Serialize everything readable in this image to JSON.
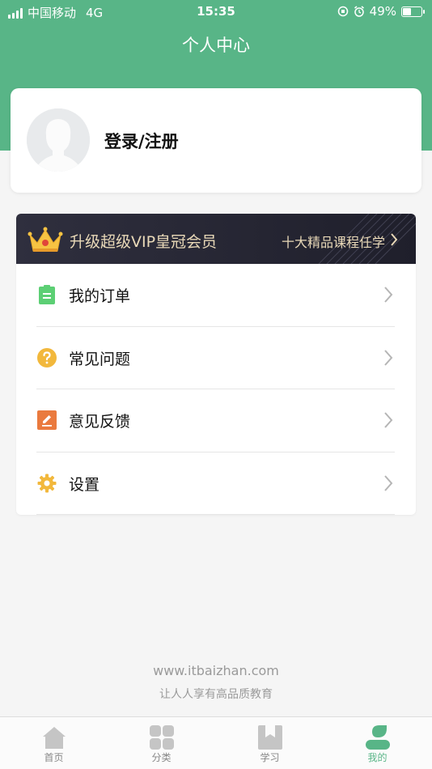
{
  "status_bar": {
    "carrier": "中国移动",
    "network": "4G",
    "time": "15:35",
    "battery": "49%",
    "battery_level": 0.49
  },
  "header": {
    "title": "个人中心"
  },
  "profile": {
    "login_label": "登录/注册",
    "avatar_icon": "default-avatar-icon"
  },
  "vip": {
    "title": "升级超级VIP皇冠会员",
    "subtitle": "十大精品课程任学",
    "icon": "crown-icon"
  },
  "menu": [
    {
      "label": "我的订单",
      "icon": "clipboard-icon",
      "color": "#5ccf74"
    },
    {
      "label": "常见问题",
      "icon": "question-icon",
      "color": "#f2b83c"
    },
    {
      "label": "意见反馈",
      "icon": "edit-icon",
      "color": "#ea7a3e"
    },
    {
      "label": "设置",
      "icon": "gear-icon",
      "color": "#f2b83c"
    }
  ],
  "footer": {
    "url": "www.itbaizhan.com",
    "slogan": "让人人享有高品质教育"
  },
  "tabs": [
    {
      "label": "首页",
      "icon": "home-icon",
      "active": false
    },
    {
      "label": "分类",
      "icon": "grid-icon",
      "active": false
    },
    {
      "label": "学习",
      "icon": "bookmark-icon",
      "active": false
    },
    {
      "label": "我的",
      "icon": "profile-icon",
      "active": true
    }
  ],
  "colors": {
    "brand_green": "#58b587",
    "vip_gold": "#e9d9b8",
    "vip_bg": "#2a2a38"
  }
}
